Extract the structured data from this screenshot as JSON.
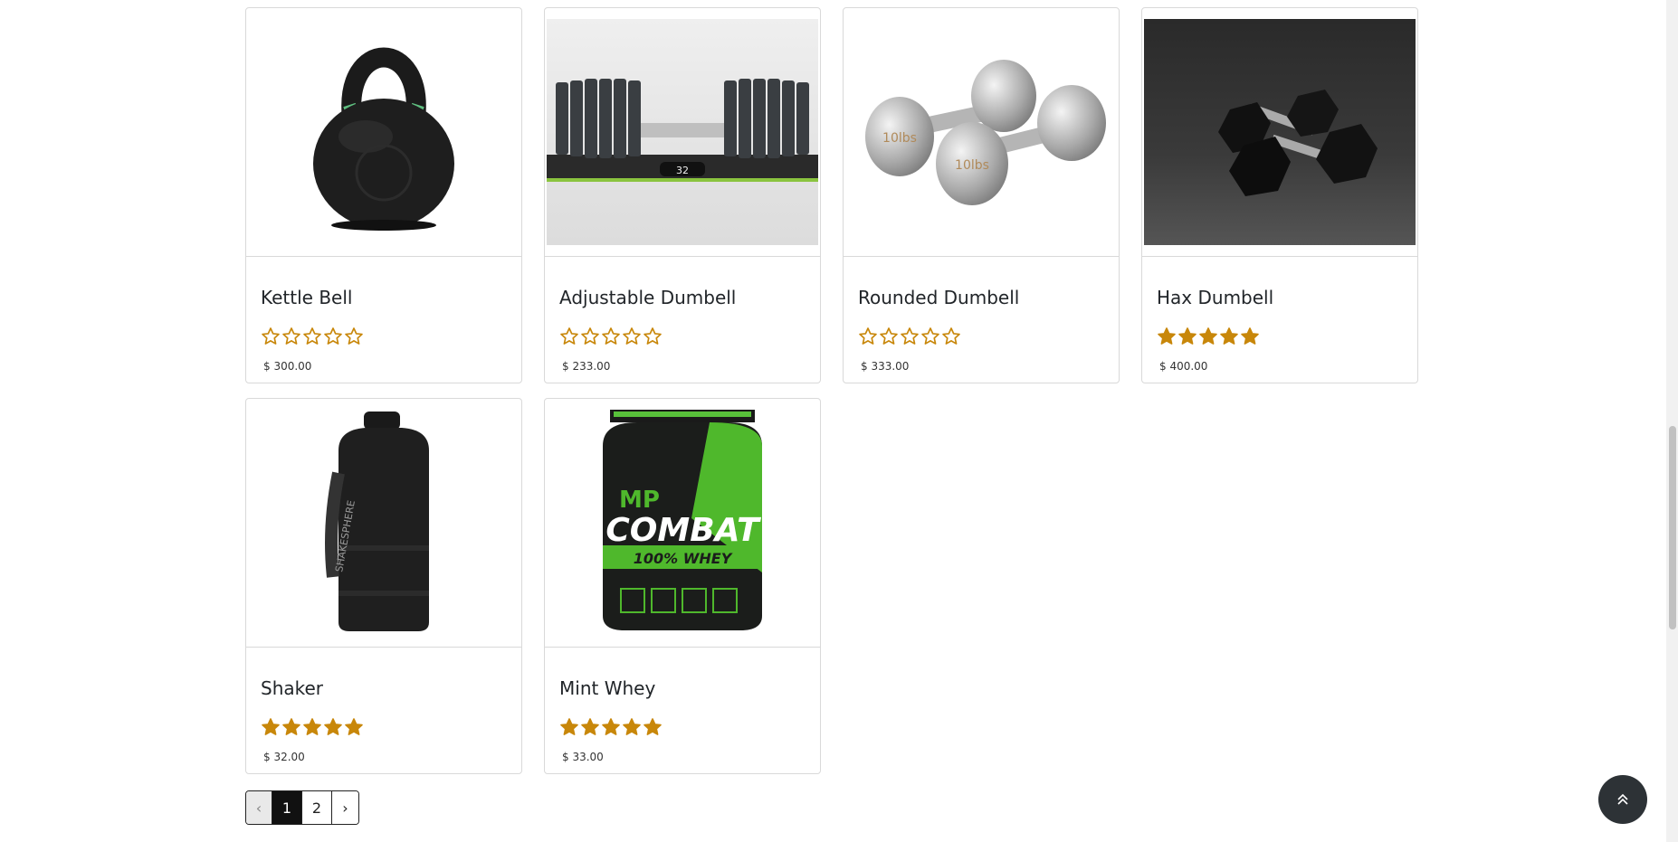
{
  "products": [
    {
      "name": "Kettle Bell",
      "price": "$ 300.00",
      "rating": 0,
      "image": "kettlebell-image"
    },
    {
      "name": "Adjustable Dumbell",
      "price": "$ 233.00",
      "rating": 0,
      "image": "adjustable-dumbbell-image"
    },
    {
      "name": "Rounded Dumbell",
      "price": "$ 333.00",
      "rating": 0,
      "image": "rounded-dumbbell-image"
    },
    {
      "name": "Hax Dumbell",
      "price": "$ 400.00",
      "rating": 5,
      "image": "hex-dumbbell-image"
    },
    {
      "name": "Shaker",
      "price": "$ 32.00",
      "rating": 5,
      "image": "shaker-image"
    },
    {
      "name": "Mint Whey",
      "price": "$ 33.00",
      "rating": 5,
      "image": "whey-image"
    }
  ],
  "rating_max": 5,
  "pagination": {
    "prev": "‹",
    "pages": [
      "1",
      "2"
    ],
    "active": "1",
    "next": "›"
  },
  "colors": {
    "star": "#c8870a",
    "accent": "#111111"
  },
  "icons": {
    "to_top": "double-chevron-up-icon",
    "star": "star-icon"
  },
  "image_text": {
    "adjustable": "32",
    "rounded": "10lbs",
    "shaker": "SHAKESPHERE",
    "whey_brand": "MP",
    "whey_name": "COMBAT",
    "whey_sub": "100% WHEY"
  }
}
